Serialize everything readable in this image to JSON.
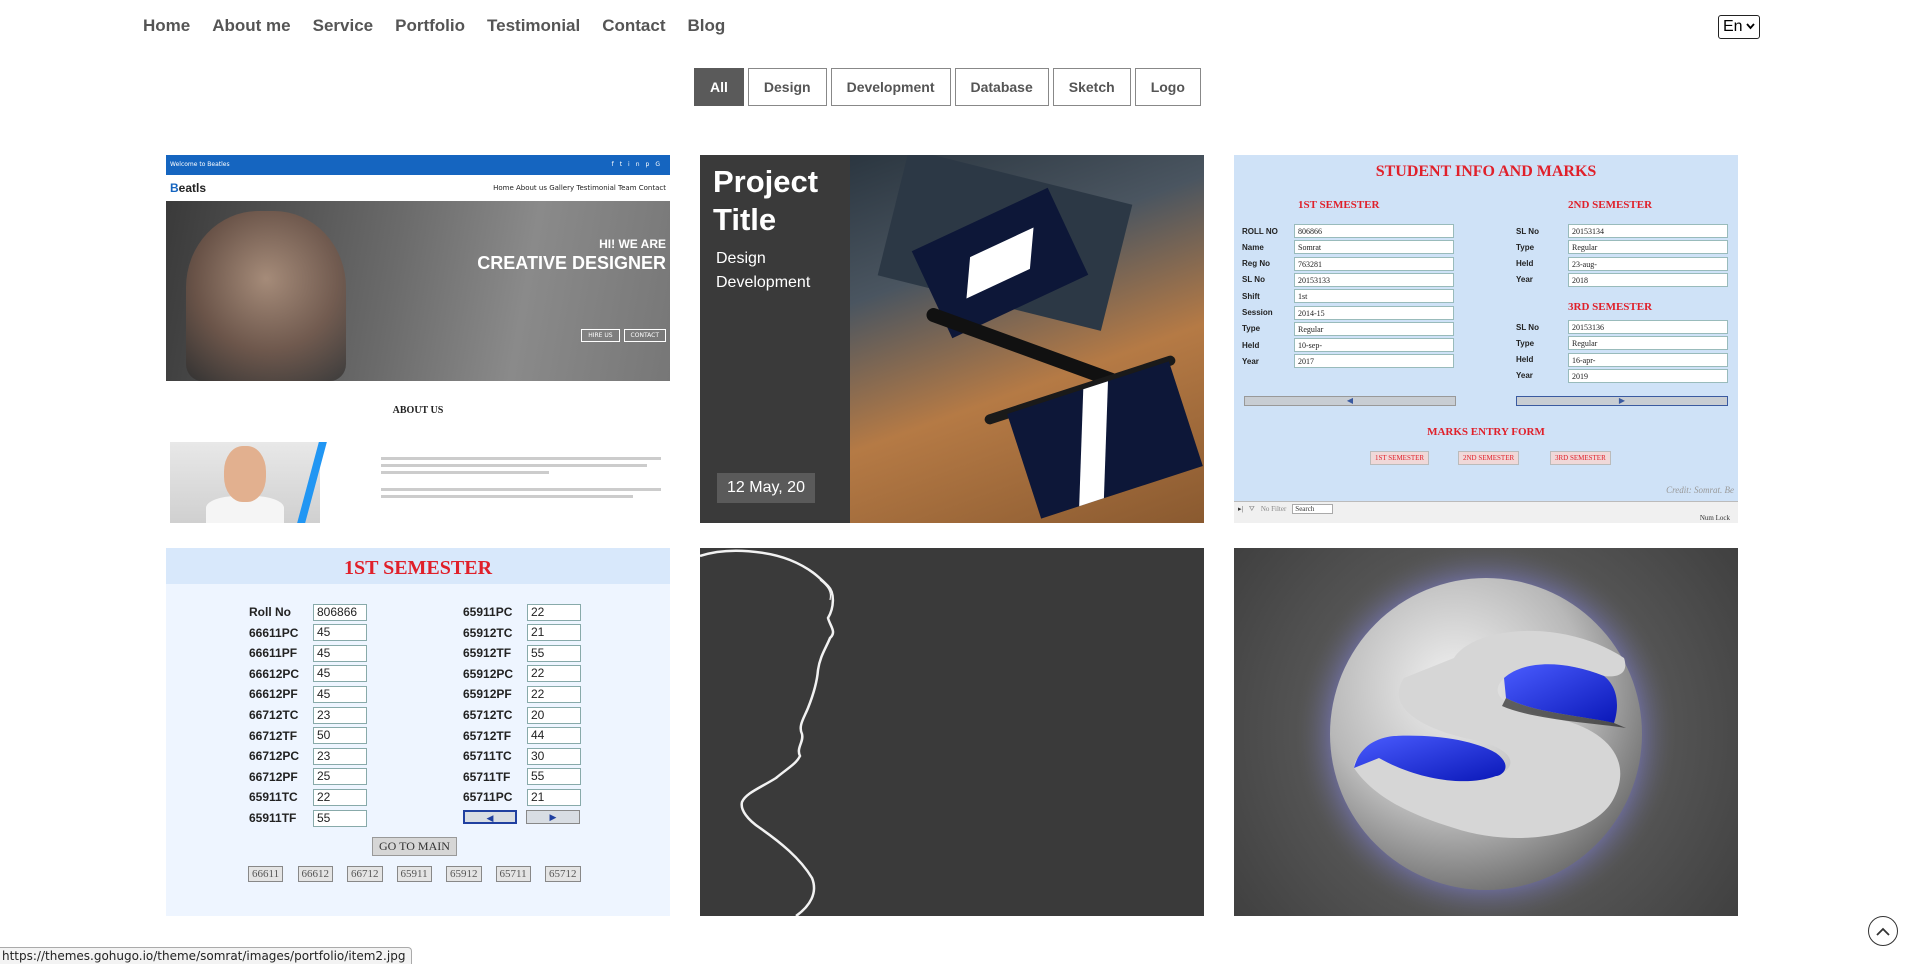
{
  "nav": {
    "items": [
      "Home",
      "About me",
      "Service",
      "Portfolio",
      "Testimonial",
      "Contact",
      "Blog"
    ]
  },
  "language": {
    "selected": "En"
  },
  "filters": {
    "items": [
      "All",
      "Design",
      "Development",
      "Database",
      "Sketch",
      "Logo"
    ],
    "active": "All"
  },
  "portfolio": {
    "card1": {
      "topbar_text": "Welcome to Beatles",
      "logo_b": "B",
      "logo_rest": "eatls",
      "menu": "Home   About us   Gallery   Testimonial   Team   Contact",
      "hero_line1": "HI! WE ARE",
      "hero_line2": "CREATIVE DESIGNER",
      "btn_hire": "HIRE US",
      "btn_contact": "CONTACT",
      "about": "ABOUT US"
    },
    "card2": {
      "title": "Project Title",
      "category1": "Design",
      "category2": "Development",
      "date": "12 May, 20"
    },
    "card3": {
      "title": "STUDENT INFO AND MARKS",
      "sem1": "1ST SEMESTER",
      "sem2": "2ND SEMESTER",
      "sem3": "3RD SEMESTER",
      "left_fields": [
        {
          "label": "ROLL NO",
          "value": "806866"
        },
        {
          "label": "Name",
          "value": "Somrat"
        },
        {
          "label": "Reg No",
          "value": "763281"
        },
        {
          "label": "SL No",
          "value": "20153133"
        },
        {
          "label": "Shift",
          "value": "1st"
        },
        {
          "label": "Session",
          "value": "2014-15"
        },
        {
          "label": "Type",
          "value": "Regular"
        },
        {
          "label": "Held",
          "value": "10-sep-"
        },
        {
          "label": "Year",
          "value": "2017"
        }
      ],
      "right_top_fields": [
        {
          "label": "SL No",
          "value": "20153134"
        },
        {
          "label": "Type",
          "value": "Regular"
        },
        {
          "label": "Held",
          "value": "23-aug-"
        },
        {
          "label": "Year",
          "value": "2018"
        }
      ],
      "right_bottom_fields": [
        {
          "label": "SL No",
          "value": "20153136"
        },
        {
          "label": "Type",
          "value": "Regular"
        },
        {
          "label": "Held",
          "value": "16-apr-"
        },
        {
          "label": "Year",
          "value": "2019"
        }
      ],
      "entry_form": "MARKS ENTRY FORM",
      "entry_buttons": [
        "1ST SEMESTER",
        "2ND SEMESTER",
        "3RD SEMESTER"
      ],
      "credit": "Credit: Somrat. Be",
      "footer_filter": "No Filter",
      "footer_search": "Search",
      "footer_numlock": "Num Lock"
    },
    "card4": {
      "title": "1ST SEMESTER",
      "left_rows": [
        {
          "label": "Roll No",
          "value": "806866"
        },
        {
          "label": "66611PC",
          "value": "45"
        },
        {
          "label": "66611PF",
          "value": "45"
        },
        {
          "label": "66612PC",
          "value": "45"
        },
        {
          "label": "66612PF",
          "value": "45"
        },
        {
          "label": "66712TC",
          "value": "23"
        },
        {
          "label": "66712TF",
          "value": "50"
        },
        {
          "label": "66712PC",
          "value": "23"
        },
        {
          "label": "66712PF",
          "value": "25"
        },
        {
          "label": "65911TC",
          "value": "22"
        },
        {
          "label": "65911TF",
          "value": "55"
        }
      ],
      "right_rows": [
        {
          "label": "65911PC",
          "value": "22"
        },
        {
          "label": "65912TC",
          "value": "21"
        },
        {
          "label": "65912TF",
          "value": "55"
        },
        {
          "label": "65912PC",
          "value": "22"
        },
        {
          "label": "65912PF",
          "value": "22"
        },
        {
          "label": "65712TC",
          "value": "20"
        },
        {
          "label": "65712TF",
          "value": "44"
        },
        {
          "label": "65711TC",
          "value": "30"
        },
        {
          "label": "65711TF",
          "value": "55"
        },
        {
          "label": "65711PC",
          "value": "21"
        }
      ],
      "go_main": "GO TO MAIN",
      "codes": [
        "66611",
        "66612",
        "66712",
        "65911",
        "65912",
        "65711",
        "65712"
      ]
    }
  },
  "status_url": "https://themes.gohugo.io/theme/somrat/images/portfolio/item2.jpg",
  "colors": {
    "accent_blue": "#1565c0",
    "form_red": "#e0202a",
    "filter_active": "#5a5a5a",
    "dark_card": "#3a3a3a"
  },
  "icons": {
    "lang_dropdown": "chevron-down-icon",
    "scroll_top": "chevron-up-circle-icon",
    "social": [
      "facebook-icon",
      "twitter-icon",
      "linkedin-icon",
      "pinterest-icon",
      "google-plus-icon"
    ]
  }
}
